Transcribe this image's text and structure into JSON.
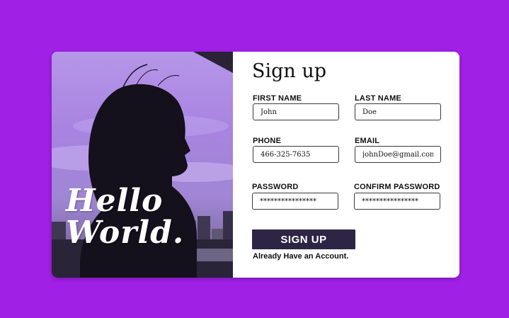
{
  "hero": {
    "line1": "Hello",
    "line2": "World."
  },
  "form": {
    "title": "Sign up",
    "first_name": {
      "label": "FIRST NAME",
      "value": "John"
    },
    "last_name": {
      "label": "LAST NAME",
      "value": "Doe"
    },
    "phone": {
      "label": "PHONE",
      "value": "466-325-7635"
    },
    "email": {
      "label": "EMAIL",
      "value": "johnDoe@gmail.com"
    },
    "password": {
      "label": "PASSWORD",
      "value": "****************"
    },
    "confirm_password": {
      "label": "CONFIRM PASSWORD",
      "value": "****************"
    },
    "submit_label": "SIGN UP",
    "login_link": "Already Have an Account."
  },
  "colors": {
    "page_background": "#a020e6",
    "button_background": "#2e2544",
    "card_background": "#ffffff"
  }
}
